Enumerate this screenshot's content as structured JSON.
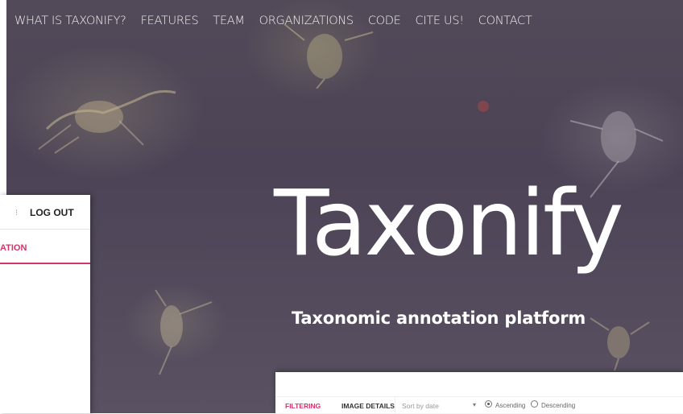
{
  "nav": {
    "items": [
      "WHAT IS TAXONIFY?",
      "FEATURES",
      "TEAM",
      "ORGANIZATIONS",
      "CODE",
      "CITE US!",
      "CONTACT"
    ]
  },
  "hero": {
    "title": "Taxonify",
    "subtitle": "Taxonomic annotation platform"
  },
  "left_window": {
    "menu_dot": "⁝",
    "logout_label": "LOG OUT",
    "tab_label": "ATION"
  },
  "bottom_window": {
    "filtering_label": "FILTERING",
    "image_details_label": "IMAGE DETAILS",
    "sort_placeholder": "Sort by date",
    "ascending_label": "Ascending",
    "descending_label": "Descending",
    "selected_order": "Ascending"
  },
  "colors": {
    "accent": "#d0366c",
    "hero_bg": "#4f4759"
  }
}
